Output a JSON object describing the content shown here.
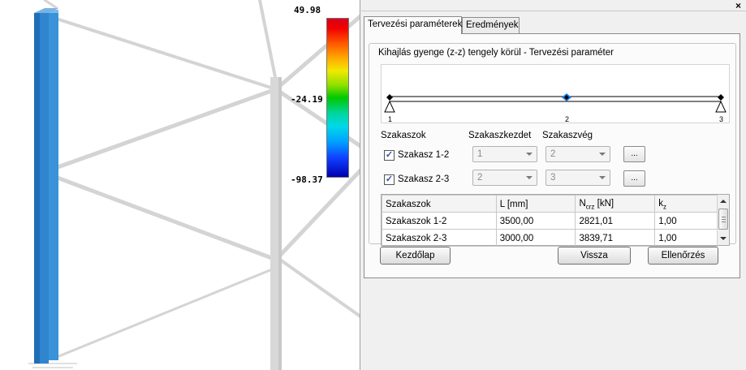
{
  "legend": {
    "max": "49.98",
    "mid": "-24.19",
    "min": "-98.37"
  },
  "panel": {
    "close": "×"
  },
  "tabs": [
    {
      "label": "Tervezési paraméterek",
      "active": true
    },
    {
      "label": "Eredmények",
      "active": false
    }
  ],
  "group": {
    "title": "Kihajlás gyenge (z-z) tengely körül - Tervezési paraméter"
  },
  "beam": {
    "nodes": [
      "1",
      "2",
      "3"
    ],
    "colors": {
      "node": "#000000",
      "selected": "#1e7ce8"
    }
  },
  "segments": {
    "headers": {
      "segments": "Szakaszok",
      "start": "Szakaszkezdet",
      "end": "Szakaszvég"
    },
    "rows": [
      {
        "checked": true,
        "check_glyph": "✓",
        "label": "Szakasz 1-2",
        "start": "1",
        "end": "2",
        "btn": "..."
      },
      {
        "checked": true,
        "check_glyph": "✓",
        "label": "Szakasz 2-3",
        "start": "2",
        "end": "3",
        "btn": "..."
      }
    ]
  },
  "table": {
    "columns": [
      "Szakaszok",
      "L [mm]",
      "Ncrz [kN]",
      "kz"
    ],
    "col_ncrz": {
      "base": "N",
      "sub": "crz",
      "unit": " [kN]"
    },
    "col_kz": {
      "base": "k",
      "sub": "z"
    },
    "rows": [
      [
        "Szakaszok 1-2",
        "3500,00",
        "2821,01",
        "1,00"
      ],
      [
        "Szakaszok 2-3",
        "3000,00",
        "3839,71",
        "1,00"
      ]
    ]
  },
  "buttons": {
    "home": "Kezdőlap",
    "back": "Vissza",
    "check": "Ellenőrzés"
  }
}
